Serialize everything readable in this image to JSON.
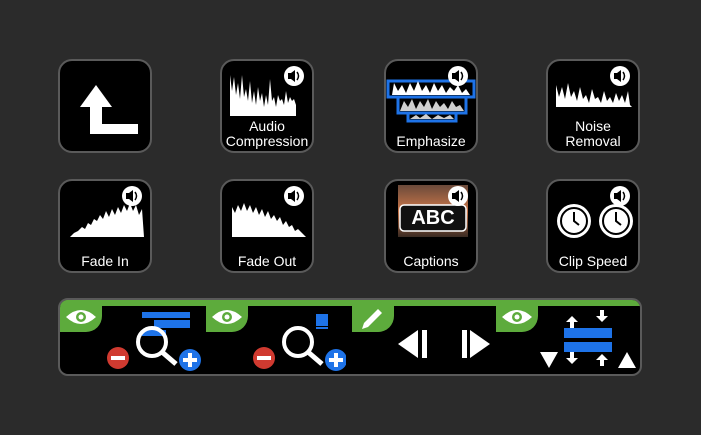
{
  "keys": [
    {
      "id": "back",
      "label": ""
    },
    {
      "id": "audio-compression",
      "label": "Audio\nCompression"
    },
    {
      "id": "emphasize",
      "label": "Emphasize"
    },
    {
      "id": "noise-removal",
      "label": "Noise\nRemoval"
    },
    {
      "id": "fade-in",
      "label": "Fade In"
    },
    {
      "id": "fade-out",
      "label": "Fade Out"
    },
    {
      "id": "captions",
      "label": "Captions",
      "badge": "ABC"
    },
    {
      "id": "clip-speed",
      "label": "Clip Speed"
    }
  ],
  "icons": {
    "speaker": "speaker-icon",
    "eye": "eye-icon",
    "pencil": "pencil-icon",
    "zoom": "magnifier-icon",
    "prev": "previous-icon",
    "next": "next-icon"
  },
  "colors": {
    "background": "#2b2b2b",
    "key": "#000000",
    "border": "#5a5a5a",
    "green": "#5dab3c",
    "blue": "#1e73e8",
    "red": "#d03a30",
    "text": "#ffffff"
  }
}
